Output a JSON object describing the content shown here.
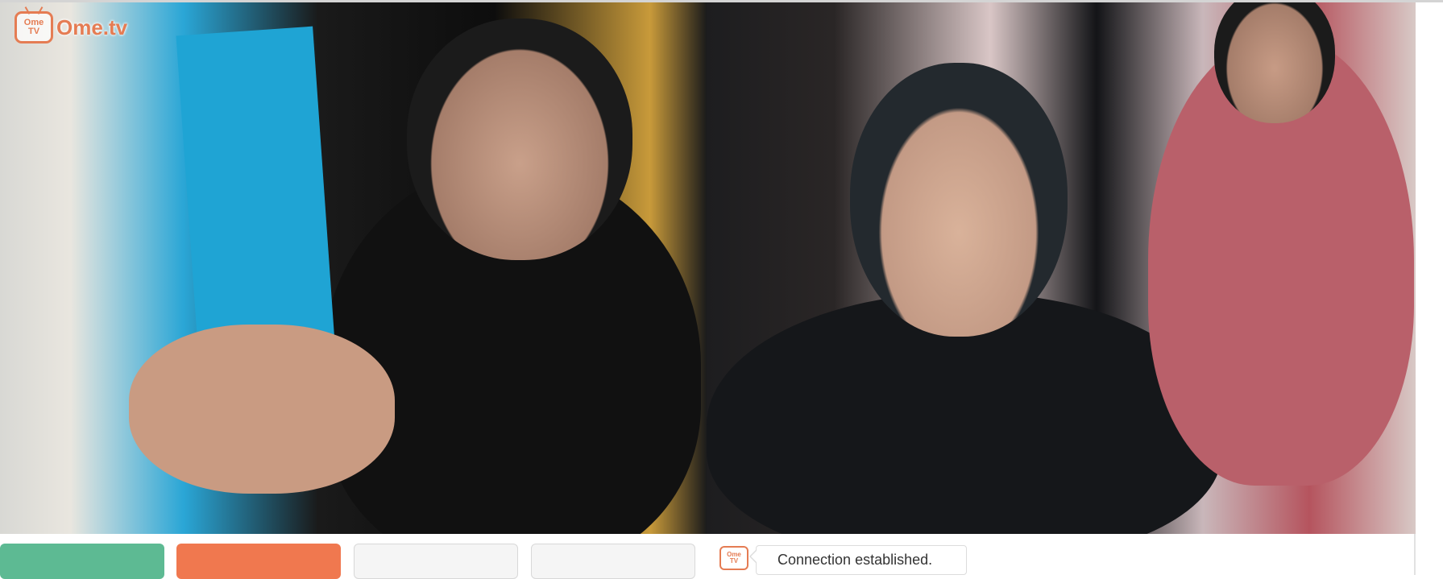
{
  "logo": {
    "tv_line1": "Ome",
    "tv_line2": "TV",
    "text": "Ome.tv"
  },
  "chat": {
    "logo_line1": "Ome",
    "logo_line2": "TV",
    "message": "Connection established."
  },
  "colors": {
    "brand_orange": "#e57c53",
    "start_green": "#5dba93",
    "stop_orange": "#f0784f",
    "neutral_button": "#f5f5f5"
  }
}
